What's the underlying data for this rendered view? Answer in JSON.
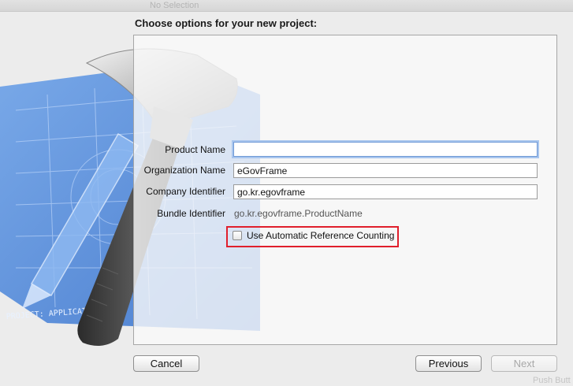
{
  "window": {
    "bg_title": "No Selection",
    "bg_corner_text": "Push Butt"
  },
  "dialog": {
    "title": "Choose options for your new project:"
  },
  "form": {
    "product_name": {
      "label": "Product Name",
      "value": ""
    },
    "organization_name": {
      "label": "Organization Name",
      "value": "eGovFrame"
    },
    "company_identifier": {
      "label": "Company Identifier",
      "value": "go.kr.egovframe"
    },
    "bundle_identifier": {
      "label": "Bundle Identifier",
      "value": "go.kr.egovframe.ProductName"
    },
    "arc_checkbox": {
      "label": "Use Automatic Reference Counting",
      "checked": false
    }
  },
  "buttons": {
    "cancel": "Cancel",
    "previous": "Previous",
    "next": "Next"
  },
  "colors": {
    "highlight": "#e01f2c",
    "focus_ring": "#a9c6ee",
    "blueprint": "#4a86d8"
  },
  "artwork": {
    "blueprint_text": "PROJECT: APPLICATION.APP",
    "icon": "xcode-hammer-blueprint-icon"
  }
}
